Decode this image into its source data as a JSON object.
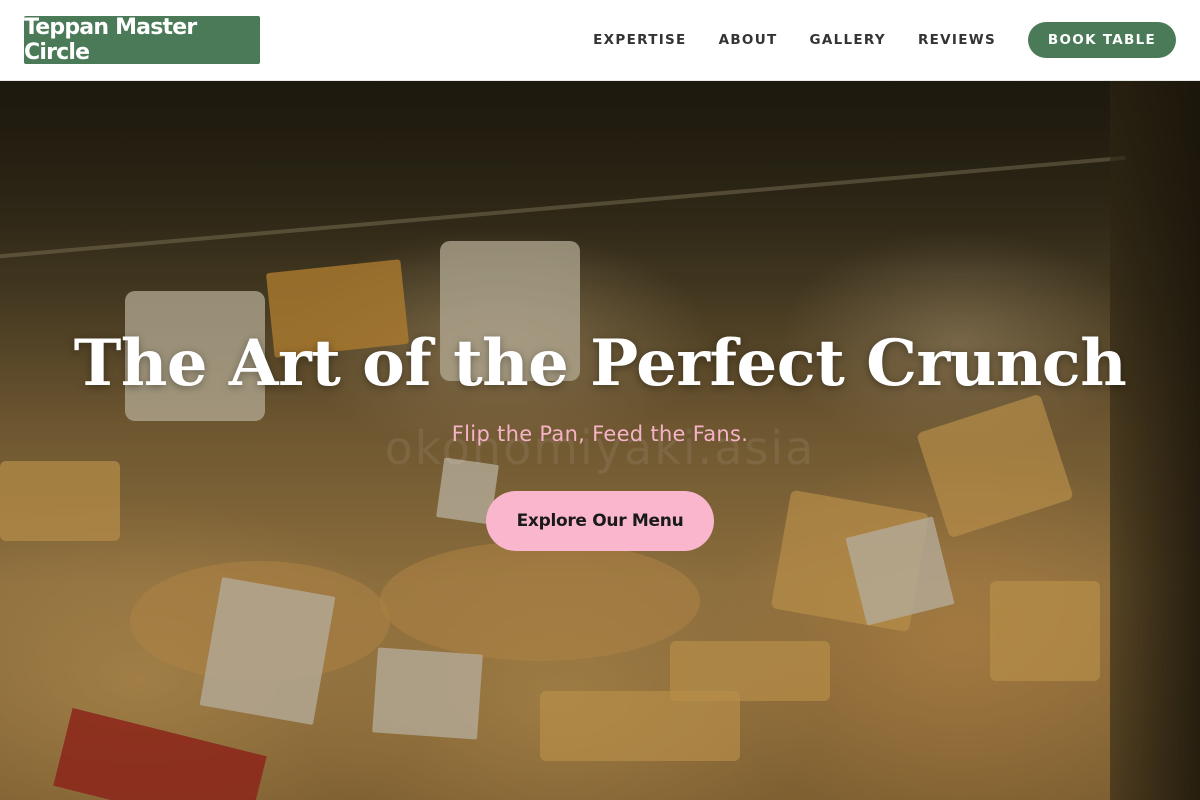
{
  "header": {
    "logo_text": "Teppan Master Circle",
    "nav": [
      {
        "label": "EXPERTISE"
      },
      {
        "label": "ABOUT"
      },
      {
        "label": "GALLERY"
      },
      {
        "label": "REVIEWS"
      }
    ],
    "book_label": "BOOK TABLE"
  },
  "hero": {
    "title": "The Art of the Perfect Crunch",
    "subtitle": "Flip the Pan, Feed the Fans.",
    "watermark": "okonomiyaki.asia",
    "cta_label": "Explore Our Menu"
  },
  "colors": {
    "brand_green": "#4a7a57",
    "cta_pink": "#f9b6cd",
    "subtitle_pink": "#f6b3c8"
  }
}
